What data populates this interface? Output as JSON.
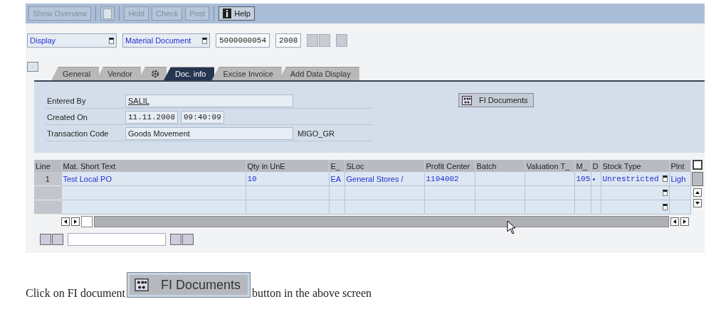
{
  "toolbar": [
    {
      "kind": "text",
      "label": "Show Overview",
      "disabled": true
    },
    {
      "kind": "icon",
      "disabled": true
    },
    {
      "kind": "text",
      "label": "Hold",
      "disabled": true
    },
    {
      "kind": "text",
      "label": "Check",
      "disabled": true
    },
    {
      "kind": "text",
      "label": "Post",
      "disabled": true
    },
    {
      "kind": "help",
      "label": "Help",
      "disabled": false
    }
  ],
  "selectors": {
    "action": "Display",
    "document_type": "Material Document",
    "document_number": "5000000054",
    "year": "2008"
  },
  "tabs": [
    {
      "kind": "text",
      "label": "General",
      "selected": false
    },
    {
      "kind": "text",
      "label": "Vendor",
      "selected": false
    },
    {
      "kind": "icon",
      "selected": false
    },
    {
      "kind": "text",
      "label": "Doc. info",
      "selected": true
    },
    {
      "kind": "text",
      "label": "Excise Invoice",
      "selected": false
    },
    {
      "kind": "text",
      "label": "Add Data Display",
      "selected": false
    }
  ],
  "doc_info": {
    "entered_by_label": "Entered By",
    "entered_by": "SALIL",
    "created_on_label": "Created On",
    "created_date": "11.11.2008",
    "created_time": "09:40:09",
    "transaction_code_label": "Transaction Code",
    "transaction_text": "Goods Movement",
    "transaction_code": "MIGO_GR",
    "fi_button": "FI Documents"
  },
  "table": {
    "columns": [
      "Line",
      "Mat. Short Text",
      "Qty in UnE",
      "E_",
      "SLoc",
      "Profit Center",
      "Batch",
      "Valuation T_",
      "M_",
      "D",
      "Stock Type",
      "Plnt"
    ],
    "rows": [
      {
        "cells": [
          "1",
          "Test Local PO",
          "10",
          "EA",
          "General Stores /",
          "1104002",
          "",
          "",
          "105",
          "•",
          "Unrestricted",
          "Ligh"
        ]
      },
      {
        "cells": [
          "",
          "",
          "",
          "",
          "",
          "",
          "",
          "",
          "",
          "",
          "",
          ""
        ]
      },
      {
        "cells": [
          "",
          "",
          "",
          "",
          "",
          "",
          "",
          "",
          "",
          "",
          "",
          ""
        ]
      }
    ]
  },
  "caption": {
    "before": "Click on FI document",
    "button": "FI Documents",
    "after": "button in the above screen"
  }
}
